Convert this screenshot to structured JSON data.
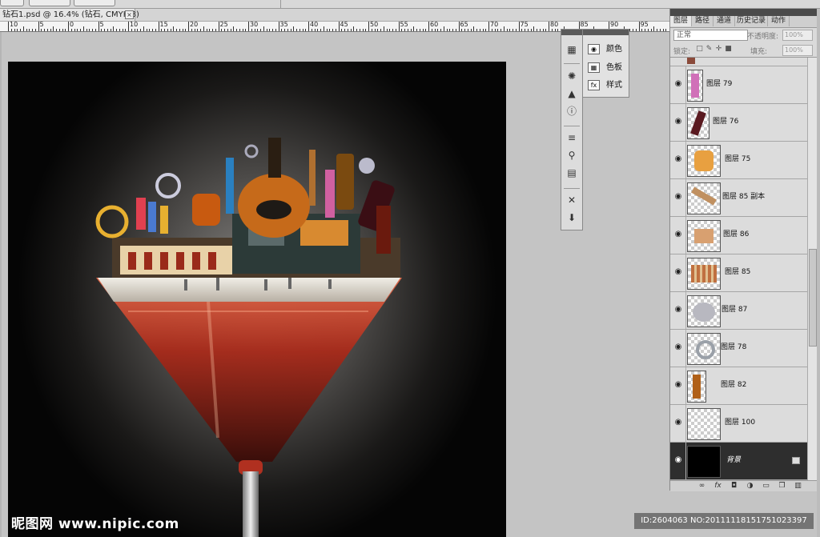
{
  "option_bar": {
    "buttons": [
      "",
      "",
      ""
    ]
  },
  "document": {
    "tab_title": "钻石1.psd @ 16.4% (钻石, CMYK/8)",
    "close_label": "×"
  },
  "ruler": {
    "labels": [
      "10",
      "5",
      "0",
      "5",
      "10",
      "15",
      "20",
      "25",
      "30",
      "35",
      "40",
      "45",
      "50",
      "55",
      "60",
      "65",
      "70",
      "75",
      "80",
      "85",
      "90",
      "95"
    ]
  },
  "watermark": {
    "site": "昵图网 www.nipic.com",
    "id_text": "ID:2604063 NO:20111118151751023397"
  },
  "flyout": {
    "items": [
      {
        "label": "颜色",
        "icon": "color-palette-icon"
      },
      {
        "label": "色板",
        "icon": "swatches-icon"
      },
      {
        "label": "样式",
        "icon": "styles-icon"
      }
    ]
  },
  "dock": {
    "icons": [
      "color-icon",
      "navigator-icon",
      "histogram-icon",
      "info-icon",
      "brushes-icon",
      "clone-source-icon",
      "tool-presets-icon",
      "tools-icon",
      "actions-icon"
    ]
  },
  "layers_panel": {
    "tabs": [
      "图层",
      "路径",
      "通道",
      "历史记录",
      "动作"
    ],
    "blend_mode": "正常",
    "opacity_label": "不透明度:",
    "opacity_value": "100%",
    "lock_label": "锁定:",
    "fill_label": "填充:",
    "fill_value": "100%",
    "layers": [
      {
        "name": "图层 79",
        "thumb": "pink-bottle"
      },
      {
        "name": "图层 76",
        "thumb": "wine-bottle"
      },
      {
        "name": "图层 75",
        "thumb": "perfume"
      },
      {
        "name": "图层 85 副本",
        "thumb": "lipsticks"
      },
      {
        "name": "图层 86",
        "thumb": "bag"
      },
      {
        "name": "图层 85",
        "thumb": "cosmetics"
      },
      {
        "name": "图层 87",
        "thumb": "diamond"
      },
      {
        "name": "图层 78",
        "thumb": "ring"
      },
      {
        "name": "图层 82",
        "thumb": "cognac"
      },
      {
        "name": "图层 100",
        "thumb": "blank"
      },
      {
        "name": "背景",
        "thumb": "black"
      }
    ],
    "bottom_icons": [
      "link-icon",
      "fx-icon",
      "mask-icon",
      "adjustment-icon",
      "group-icon",
      "new-layer-icon",
      "trash-icon"
    ]
  },
  "colors": {
    "panel_bg": "#dadada",
    "canvas_bg": "#c4c4c4",
    "selected_layer": "#2e2e2e"
  }
}
